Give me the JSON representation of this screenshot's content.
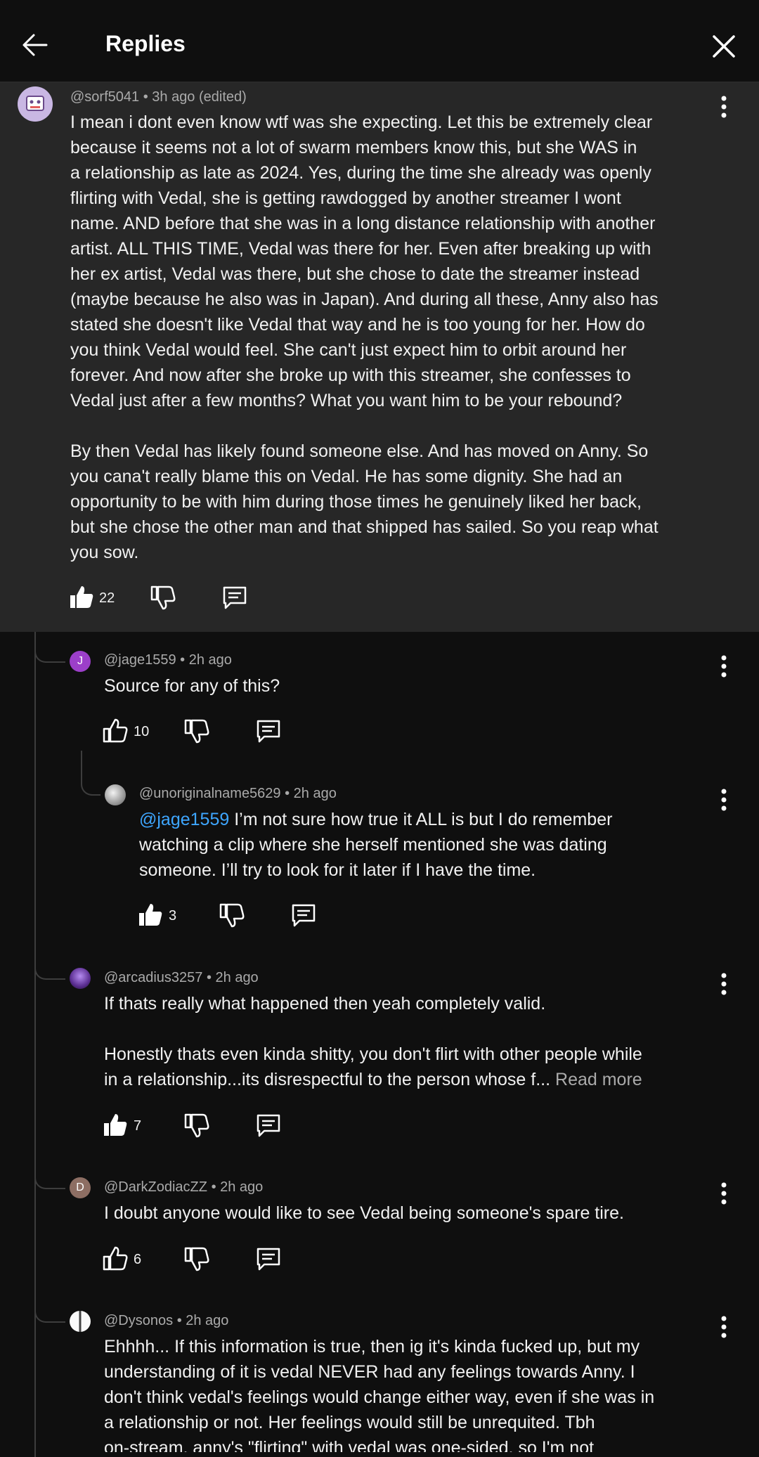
{
  "header": {
    "title": "Replies"
  },
  "parent": {
    "author": "@sorf5041",
    "time": "• 3h ago (edited)",
    "text": "I mean i dont even know wtf was she expecting. Let this be extremely clear\nbecause it seems not a lot of swarm members know this, but she WAS in\na relationship as late as 2024. Yes, during the time she already was openly\nflirting with Vedal, she is getting rawdogged by another streamer I wont\nname. AND before that she was in a long distance relationship with another\nartist. ALL THIS TIME, Vedal was there for her. Even after breaking up with\nher ex artist, Vedal was there, but she chose to date the streamer instead\n(maybe because he also was in Japan). And during all these, Anny also has\nstated she doesn't like Vedal that way and he is too young for her. How do\nyou think Vedal would feel. She can't just expect him to orbit around her\nforever. And now after she broke up with this streamer, she confesses to\nVedal just after a few months? What you want him to be your rebound?\n\nBy then Vedal has likely found someone else. And has moved on Anny. So\nyou cana't really blame this on Vedal. He has some dignity. She had an\nopportunity to be with him during those times he genuinely liked her back,\nbut she chose the other man and that shipped has sailed. So you reap what\nyou sow.",
    "likes": "22"
  },
  "replies": [
    {
      "avatar_letter": "J",
      "avatar_color": "#9c3fc9",
      "author": "@jage1559",
      "time": "• 2h ago",
      "text": "Source for any of this?",
      "likes": "10"
    },
    {
      "avatar_letter": "",
      "avatar_color": "#d9d9d9",
      "author": "@unoriginalname5629",
      "time": "• 2h ago",
      "mention": "@jage1559",
      "text": " I’m not sure how true it ALL is but I do remember\nwatching a clip where she herself mentioned she was dating\nsomeone. I’ll try to look for it later if I have the time.",
      "likes": "3"
    },
    {
      "avatar_letter": "",
      "avatar_color": "#5b2e91",
      "author": "@arcadius3257",
      "time": "• 2h ago",
      "text": "If thats really what happened then yeah completely valid.\n\nHonestly thats even kinda shitty, you don't flirt with other people while\nin a relationship...its disrespectful to the person whose f...",
      "read_more": "Read more",
      "likes": "7"
    },
    {
      "avatar_letter": "D",
      "avatar_color": "#8d6e63",
      "author": "@DarkZodiacZZ",
      "time": "• 2h ago",
      "text": "I doubt anyone would like to see Vedal being someone's spare tire.",
      "likes": "6"
    },
    {
      "avatar_letter": "",
      "avatar_color": "#e0e0e0",
      "author": "@Dysonos",
      "time": "• 2h ago",
      "text": "Ehhhh... If this information is true, then ig it's kinda fucked up, but my\nunderstanding of it is vedal NEVER had any feelings towards Anny. I\ndon't think vedal's feelings would change either way, even if she was in\na relationship or not. Her feelings would still be unrequited. Tbh\non-stream, anny's \"flirting\" with vedal was one-sided, so I'm not"
    }
  ],
  "icons": {
    "back": "arrow-left-icon",
    "close": "close-icon",
    "menu": "more-vert-icon",
    "like": "thumb-up-icon",
    "dislike": "thumb-down-icon",
    "reply": "comment-icon"
  }
}
